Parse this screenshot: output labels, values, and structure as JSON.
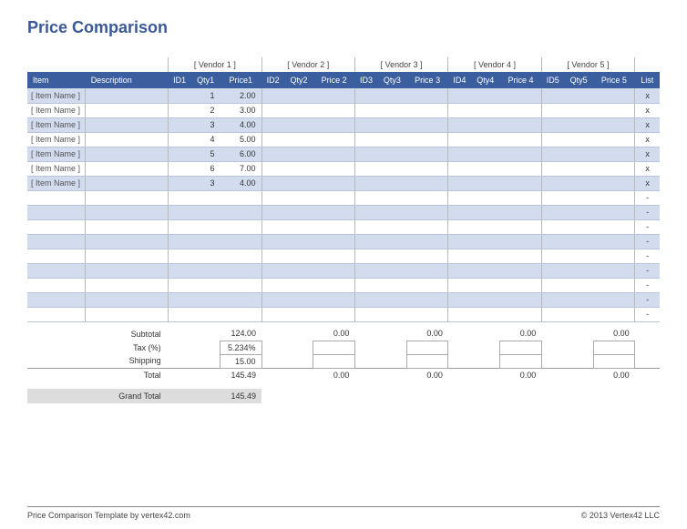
{
  "title": "Price Comparison",
  "vendors": [
    "[ Vendor 1 ]",
    "[ Vendor 2 ]",
    "[ Vendor 3 ]",
    "[ Vendor 4 ]",
    "[ Vendor 5 ]"
  ],
  "headers": {
    "item": "Item",
    "desc": "Description",
    "v": [
      {
        "id": "ID1",
        "qty": "Qty1",
        "price": "Price1"
      },
      {
        "id": "ID2",
        "qty": "Qty2",
        "price": "Price 2"
      },
      {
        "id": "ID3",
        "qty": "Qty3",
        "price": "Price 3"
      },
      {
        "id": "ID4",
        "qty": "Qty4",
        "price": "Price 4"
      },
      {
        "id": "ID5",
        "qty": "Qty5",
        "price": "Price 5"
      }
    ],
    "list": "List"
  },
  "rows": [
    {
      "item": "[ Item Name ]",
      "qty1": "1",
      "price1": "2.00",
      "list": "x"
    },
    {
      "item": "[ Item Name ]",
      "qty1": "2",
      "price1": "3.00",
      "list": "x"
    },
    {
      "item": "[ Item Name ]",
      "qty1": "3",
      "price1": "4.00",
      "list": "x"
    },
    {
      "item": "[ Item Name ]",
      "qty1": "4",
      "price1": "5.00",
      "list": "x"
    },
    {
      "item": "[ Item Name ]",
      "qty1": "5",
      "price1": "6.00",
      "list": "x"
    },
    {
      "item": "[ Item Name ]",
      "qty1": "6",
      "price1": "7.00",
      "list": "x"
    },
    {
      "item": "[ Item Name ]",
      "qty1": "3",
      "price1": "4.00",
      "list": "x"
    },
    {
      "item": "",
      "qty1": "",
      "price1": "",
      "list": "-"
    },
    {
      "item": "",
      "qty1": "",
      "price1": "",
      "list": "-"
    },
    {
      "item": "",
      "qty1": "",
      "price1": "",
      "list": "-"
    },
    {
      "item": "",
      "qty1": "",
      "price1": "",
      "list": "-"
    },
    {
      "item": "",
      "qty1": "",
      "price1": "",
      "list": "-"
    },
    {
      "item": "",
      "qty1": "",
      "price1": "",
      "list": "-"
    },
    {
      "item": "",
      "qty1": "",
      "price1": "",
      "list": "-"
    },
    {
      "item": "",
      "qty1": "",
      "price1": "",
      "list": "-"
    },
    {
      "item": "",
      "qty1": "",
      "price1": "",
      "list": "-"
    }
  ],
  "summary": {
    "subtotal_label": "Subtotal",
    "tax_label": "Tax (%)",
    "shipping_label": "Shipping",
    "total_label": "Total",
    "grand_label": "Grand Total",
    "subtotal": [
      "124.00",
      "0.00",
      "0.00",
      "0.00",
      "0.00"
    ],
    "tax": "5.234%",
    "shipping": "15.00",
    "total": [
      "145.49",
      "0.00",
      "0.00",
      "0.00",
      "0.00"
    ],
    "grand": "145.49"
  },
  "footer": {
    "left": "Price Comparison Template by vertex42.com",
    "right": "© 2013 Vertex42 LLC"
  }
}
